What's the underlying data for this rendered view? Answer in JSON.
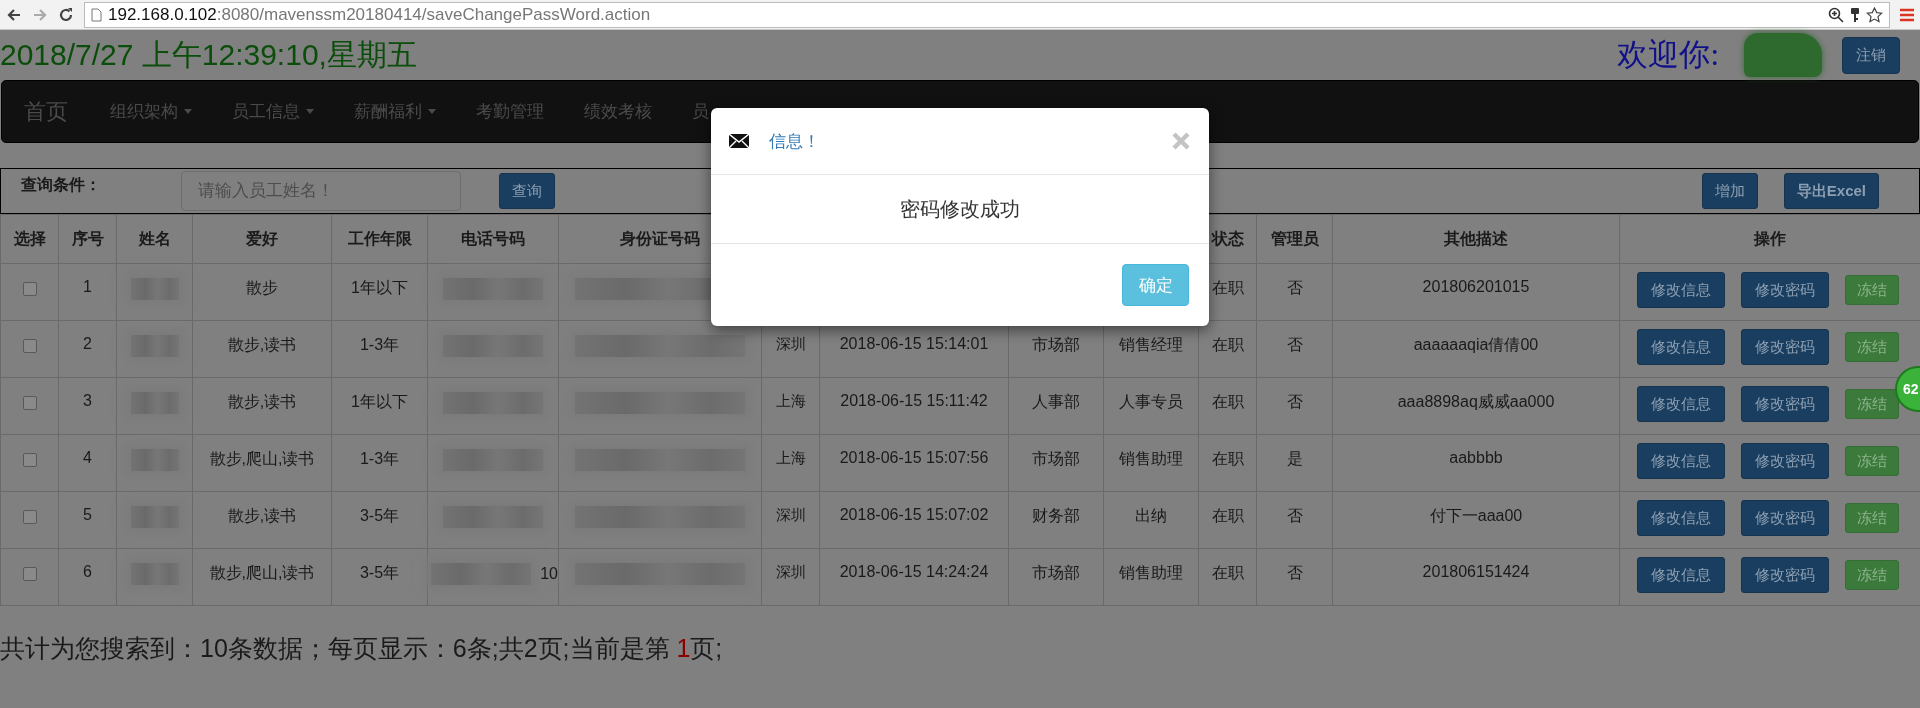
{
  "browser": {
    "url_host": "192.168.0.102",
    "url_rest": ":8080/mavenssm20180414/saveChangePassWord.action"
  },
  "header": {
    "datetime": "2018/7/27 上午12:39:10,星期五",
    "welcome": "欢迎你:",
    "logout": "注销"
  },
  "nav": {
    "brand": "首页",
    "items": [
      {
        "label": "组织架构",
        "dropdown": true
      },
      {
        "label": "员工信息",
        "dropdown": true
      },
      {
        "label": "薪酬福利",
        "dropdown": true
      },
      {
        "label": "考勤管理",
        "dropdown": false
      },
      {
        "label": "绩效考核",
        "dropdown": false
      },
      {
        "label": "员",
        "dropdown": false
      }
    ]
  },
  "search": {
    "label": "查询条件：",
    "placeholder": "请输入员工姓名！",
    "search_button": "查询",
    "add_button": "增加",
    "export_button": "导出Excel"
  },
  "table": {
    "columns": [
      {
        "label": "选择"
      },
      {
        "label": "序号"
      },
      {
        "label": "姓名"
      },
      {
        "label": "爱好"
      },
      {
        "label": "工作年限"
      },
      {
        "label": "电话号码"
      },
      {
        "label": "身份证号码"
      },
      {},
      {},
      {},
      {},
      {
        "label": "状态"
      },
      {
        "label": "管理员"
      },
      {
        "label": "其他描述"
      },
      {
        "label": "操作"
      }
    ],
    "rows": [
      {
        "checked": false,
        "no": "1",
        "hobby": "散步",
        "years": "1年以下",
        "status": "在职",
        "admin": "否",
        "desc": "201806201015",
        "actions": [
          {
            "label": "修改信息",
            "kind": "primary"
          },
          {
            "label": "修改密码",
            "kind": "primary"
          },
          {
            "label": "冻结",
            "kind": "success"
          }
        ]
      },
      {
        "checked": false,
        "no": "2",
        "hobby": "散步,读书",
        "years": "1-3年",
        "city": "深圳",
        "joined": "2018-06-15 15:14:01",
        "dept": "市场部",
        "position": "销售经理",
        "status": "在职",
        "admin": "否",
        "desc": "aaaaaaqia倩倩00",
        "actions": [
          {
            "label": "修改信息",
            "kind": "primary"
          },
          {
            "label": "修改密码",
            "kind": "primary"
          },
          {
            "label": "冻结",
            "kind": "success"
          }
        ]
      },
      {
        "checked": false,
        "no": "3",
        "hobby": "散步,读书",
        "years": "1年以下",
        "city": "上海",
        "joined": "2018-06-15 15:11:42",
        "dept": "人事部",
        "position": "人事专员",
        "status": "在职",
        "admin": "否",
        "desc": "aaa8898aq威威aa000",
        "actions": [
          {
            "label": "修改信息",
            "kind": "primary"
          },
          {
            "label": "修改密码",
            "kind": "primary"
          },
          {
            "label": "冻结",
            "kind": "success"
          }
        ]
      },
      {
        "checked": false,
        "no": "4",
        "hobby": "散步,爬山,读书",
        "years": "1-3年",
        "city": "上海",
        "joined": "2018-06-15 15:07:56",
        "dept": "市场部",
        "position": "销售助理",
        "status": "在职",
        "admin": "是",
        "desc": "aabbbb",
        "actions": [
          {
            "label": "修改信息",
            "kind": "primary"
          },
          {
            "label": "修改密码",
            "kind": "primary"
          },
          {
            "label": "冻结",
            "kind": "success"
          }
        ]
      },
      {
        "checked": false,
        "no": "5",
        "hobby": "散步,读书",
        "years": "3-5年",
        "city": "深圳",
        "joined": "2018-06-15 15:07:02",
        "dept": "财务部",
        "position": "出纳",
        "status": "在职",
        "admin": "否",
        "desc": "付下一aaa00",
        "actions": [
          {
            "label": "修改信息",
            "kind": "primary"
          },
          {
            "label": "修改密码",
            "kind": "primary"
          },
          {
            "label": "冻结",
            "kind": "success"
          }
        ]
      },
      {
        "checked": false,
        "no": "6",
        "hobby": "散步,爬山,读书",
        "years": "3-5年",
        "phone_tail": "10",
        "city": "深圳",
        "joined": "2018-06-15 14:24:24",
        "dept": "市场部",
        "position": "销售助理",
        "status": "在职",
        "admin": "否",
        "desc": "201806151424",
        "actions": [
          {
            "label": "修改信息",
            "kind": "primary"
          },
          {
            "label": "修改密码",
            "kind": "primary"
          },
          {
            "label": "冻结",
            "kind": "success"
          }
        ]
      }
    ]
  },
  "summary": {
    "before": "共计为您搜索到：10条数据；每页显示：6条;共2页;当前是第 ",
    "current_page": "1",
    "after": "页;"
  },
  "floating_badge": "62",
  "modal": {
    "title": "信息！",
    "message": "密码修改成功",
    "ok_button": "确定"
  }
}
